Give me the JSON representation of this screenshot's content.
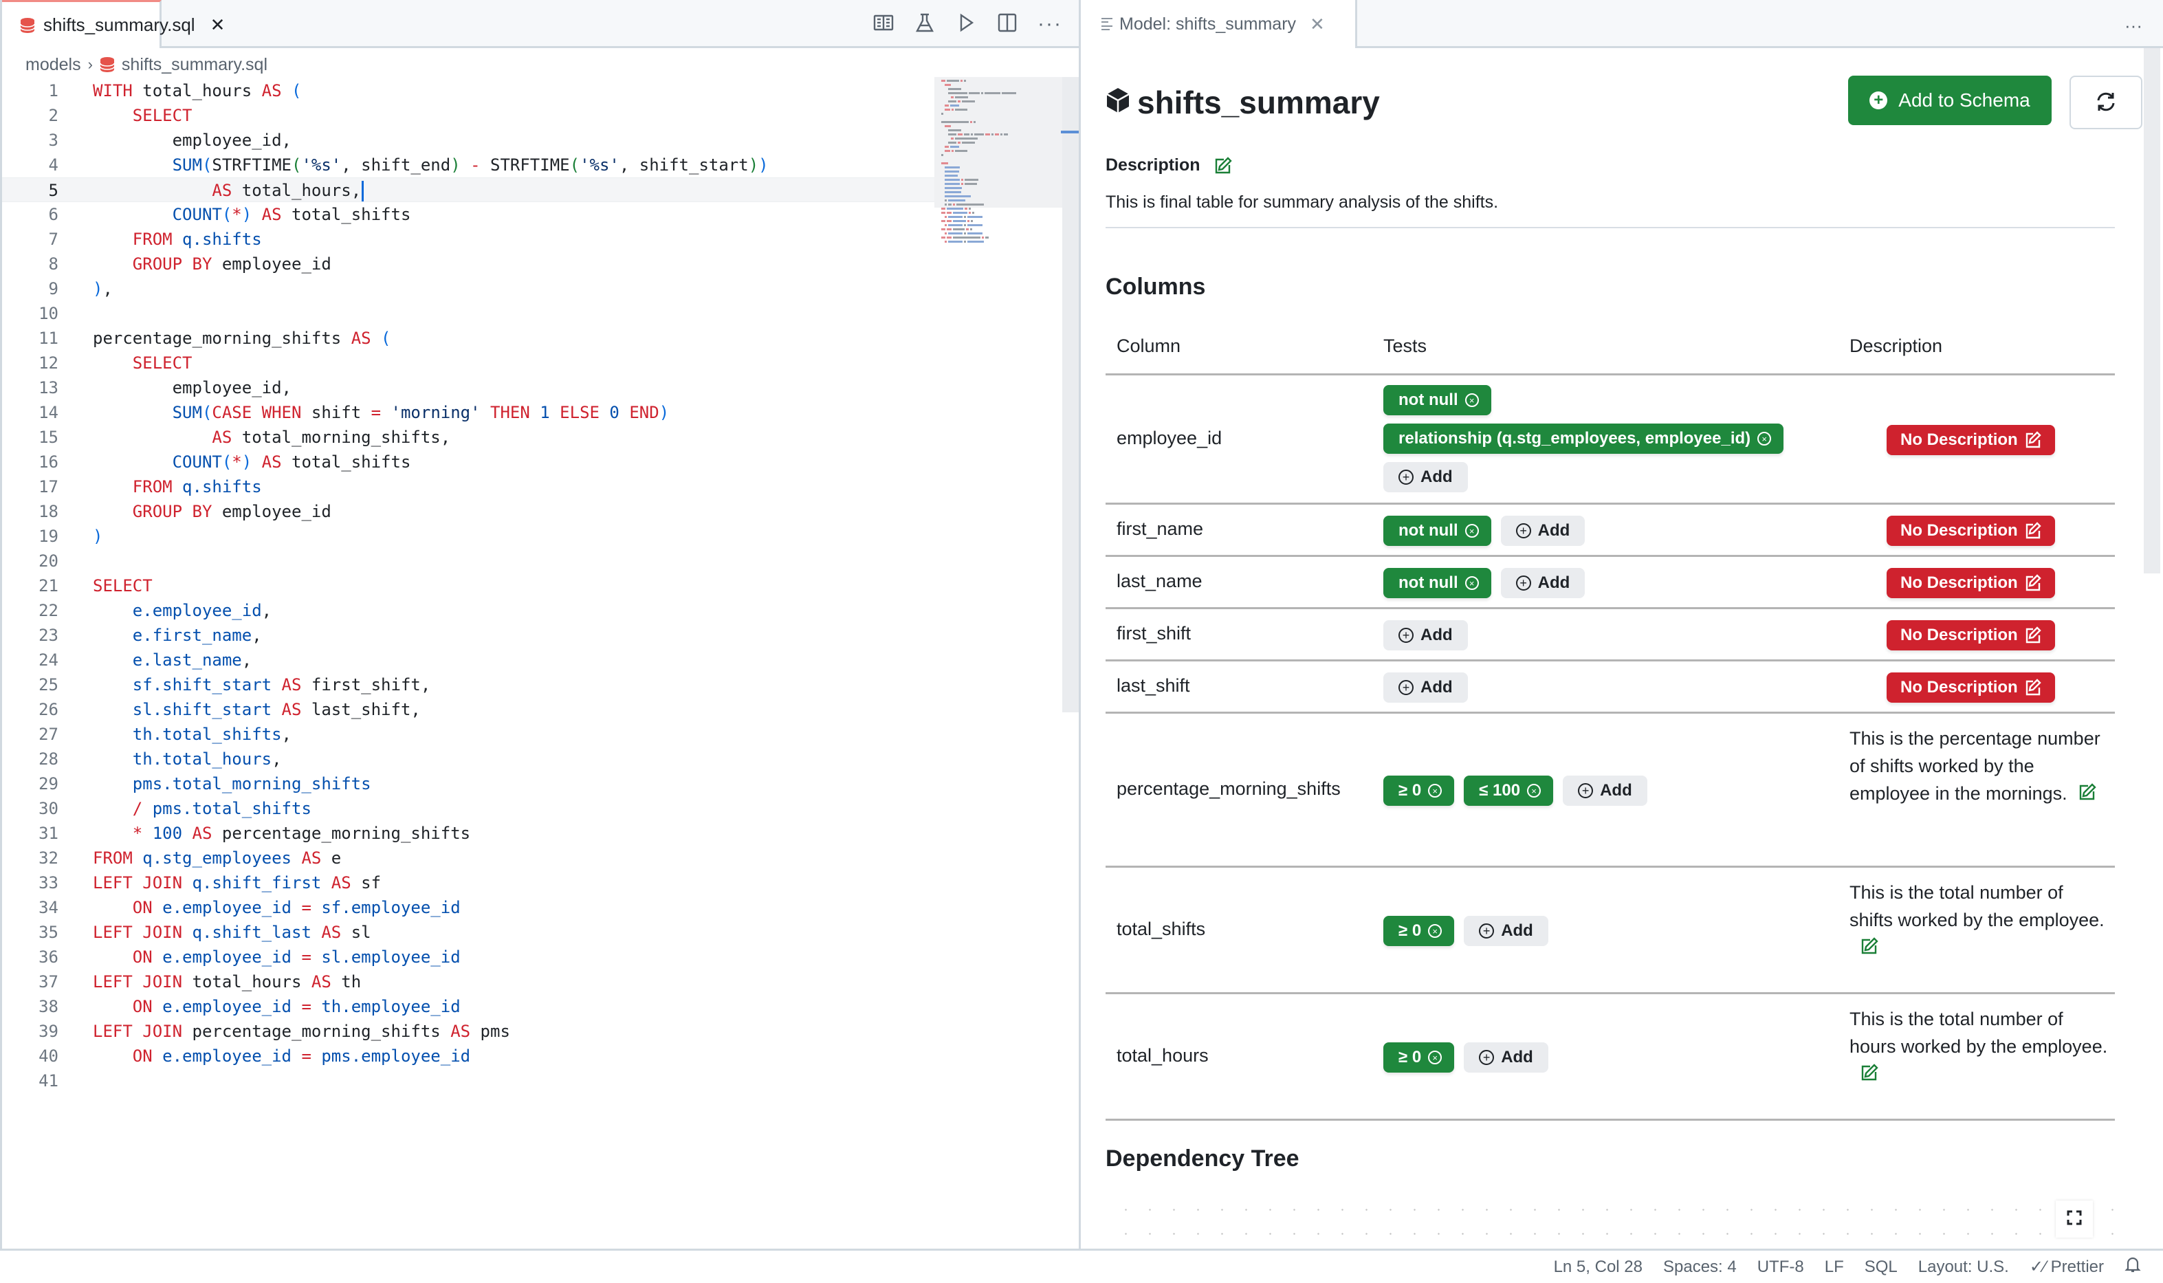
{
  "editor": {
    "tab": {
      "label": "shifts_summary.sql",
      "icon": "database-icon",
      "close": "✕"
    },
    "actions": [
      {
        "name": "open-preview-icon"
      },
      {
        "name": "test-beaker-icon"
      },
      {
        "name": "run-icon"
      },
      {
        "name": "split-editor-icon"
      },
      {
        "name": "more-actions-icon",
        "label": "···"
      }
    ],
    "breadcrumb": {
      "folder": "models",
      "separator": "›",
      "file": "shifts_summary.sql"
    },
    "current_line": 5,
    "lines": [
      "WITH total_hours AS (",
      "    SELECT",
      "        employee_id,",
      "        SUM(STRFTIME('%s', shift_end) - STRFTIME('%s', shift_start))",
      "            AS total_hours,",
      "        COUNT(*) AS total_shifts",
      "    FROM q.shifts",
      "    GROUP BY employee_id",
      "),",
      "",
      "percentage_morning_shifts AS (",
      "    SELECT",
      "        employee_id,",
      "        SUM(CASE WHEN shift = 'morning' THEN 1 ELSE 0 END)",
      "            AS total_morning_shifts,",
      "        COUNT(*) AS total_shifts",
      "    FROM q.shifts",
      "    GROUP BY employee_id",
      ")",
      "",
      "SELECT",
      "    e.employee_id,",
      "    e.first_name,",
      "    e.last_name,",
      "    sf.shift_start AS first_shift,",
      "    sl.shift_start AS last_shift,",
      "    th.total_shifts,",
      "    th.total_hours,",
      "    pms.total_morning_shifts",
      "    / pms.total_shifts",
      "    * 100 AS percentage_morning_shifts",
      "FROM q.stg_employees AS e",
      "LEFT JOIN q.shift_first AS sf",
      "    ON e.employee_id = sf.employee_id",
      "LEFT JOIN q.shift_last AS sl",
      "    ON e.employee_id = sl.employee_id",
      "LEFT JOIN total_hours AS th",
      "    ON e.employee_id = th.employee_id",
      "LEFT JOIN percentage_morning_shifts AS pms",
      "    ON e.employee_id = pms.employee_id",
      ""
    ]
  },
  "model_panel": {
    "tab": {
      "label": "Model: shifts_summary",
      "close": "✕"
    },
    "more": "···",
    "title": "shifts_summary",
    "add_to_schema_label": "Add to Schema",
    "description_label": "Description",
    "description": "This is final table for summary analysis of the shifts.",
    "columns_heading": "Columns",
    "table_headers": {
      "column": "Column",
      "tests": "Tests",
      "description": "Description"
    },
    "add_label": "Add",
    "no_description_label": "No Description",
    "columns": [
      {
        "name": "employee_id",
        "tests": [
          "not null",
          "relationship (q.stg_employees, employee_id)"
        ],
        "description": null
      },
      {
        "name": "first_name",
        "tests": [
          "not null"
        ],
        "description": null
      },
      {
        "name": "last_name",
        "tests": [
          "not null"
        ],
        "description": null
      },
      {
        "name": "first_shift",
        "tests": [],
        "description": null
      },
      {
        "name": "last_shift",
        "tests": [],
        "description": null
      },
      {
        "name": "percentage_morning_shifts",
        "tests": [
          "≥ 0",
          "≤ 100"
        ],
        "description": "This is the percentage number of shifts worked by the employee in the mornings."
      },
      {
        "name": "total_shifts",
        "tests": [
          "≥ 0"
        ],
        "description": "This is the total number of shifts worked by the employee."
      },
      {
        "name": "total_hours",
        "tests": [
          "≥ 0"
        ],
        "description": "This is the total number of hours worked by the employee."
      }
    ],
    "dependency_heading": "Dependency Tree"
  },
  "statusbar": {
    "position": "Ln 5, Col 28",
    "spaces": "Spaces: 4",
    "encoding": "UTF-8",
    "eol": "LF",
    "language": "SQL",
    "layout": "Layout: U.S.",
    "prettier": "Prettier"
  },
  "colors": {
    "accent_green": "#1f883d",
    "danger_red": "#cf222e",
    "keyword": "#cf222e",
    "identifier_blue": "#0550ae"
  }
}
